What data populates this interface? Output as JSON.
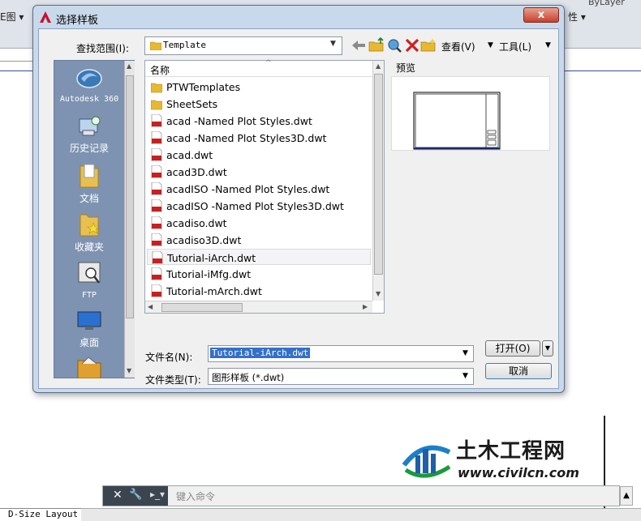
{
  "background": {
    "left_label": "E图 ▾",
    "right_label": "性 ▾",
    "right_label2": "ByLayer",
    "command_prompt": "▸_▾",
    "command_placeholder": "键入命令",
    "layout_tab": "D-Size Layout"
  },
  "watermark": {
    "title": "土木工程网",
    "url": "www.civilcn.com"
  },
  "dialog": {
    "title": "选择样板",
    "close_label": "x",
    "look_in_label": "查找范围(I):",
    "look_in_value": "Template",
    "toolbar": {
      "view_label": "查看(V)",
      "tools_label": "工具(L)"
    },
    "places": [
      {
        "label": "Autodesk 360",
        "icon": "cloud-icon"
      },
      {
        "label": "历史记录",
        "icon": "history-icon"
      },
      {
        "label": "文档",
        "icon": "documents-folder-icon"
      },
      {
        "label": "收藏夹",
        "icon": "favorites-folder-icon"
      },
      {
        "label": "FTP",
        "icon": "ftp-icon"
      },
      {
        "label": "桌面",
        "icon": "desktop-icon"
      }
    ],
    "file_list": {
      "header": "名称",
      "items": [
        {
          "name": "PTWTemplates",
          "kind": "folder"
        },
        {
          "name": "SheetSets",
          "kind": "folder"
        },
        {
          "name": "acad -Named Plot Styles.dwt",
          "kind": "dwt"
        },
        {
          "name": "acad -Named Plot Styles3D.dwt",
          "kind": "dwt"
        },
        {
          "name": "acad.dwt",
          "kind": "dwt"
        },
        {
          "name": "acad3D.dwt",
          "kind": "dwt"
        },
        {
          "name": "acadISO -Named Plot Styles.dwt",
          "kind": "dwt"
        },
        {
          "name": "acadISO -Named Plot Styles3D.dwt",
          "kind": "dwt"
        },
        {
          "name": "acadiso.dwt",
          "kind": "dwt"
        },
        {
          "name": "acadiso3D.dwt",
          "kind": "dwt"
        },
        {
          "name": "Tutorial-iArch.dwt",
          "kind": "dwt",
          "selected": true
        },
        {
          "name": "Tutorial-iMfg.dwt",
          "kind": "dwt"
        },
        {
          "name": "Tutorial-mArch.dwt",
          "kind": "dwt"
        }
      ]
    },
    "preview_label": "预览",
    "file_name_label": "文件名(N):",
    "file_name_value": "Tutorial-iArch.dwt",
    "file_type_label": "文件类型(T):",
    "file_type_value": "图形样板 (*.dwt)",
    "open_label": "打开(O)",
    "cancel_label": "取消"
  }
}
